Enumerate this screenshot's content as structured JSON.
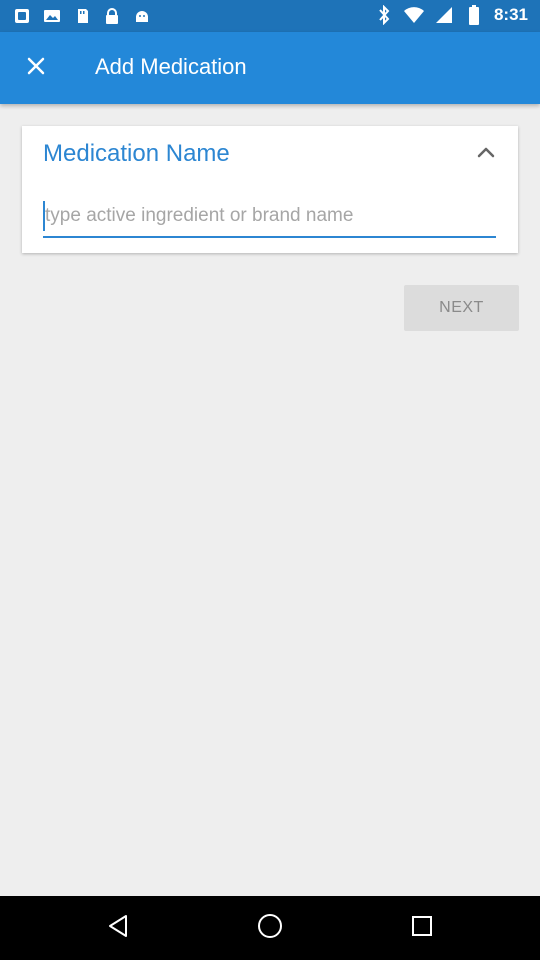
{
  "status_bar": {
    "time": "8:31",
    "left_icons": [
      "notification-app-icon",
      "photo-icon",
      "storage-icon",
      "lock-icon",
      "android-icon"
    ],
    "right_icons": [
      "bluetooth-icon",
      "wifi-icon",
      "signal-icon",
      "battery-icon"
    ]
  },
  "app_bar": {
    "close_icon": "close-icon",
    "title": "Add Medication"
  },
  "medication_card": {
    "title": "Medication Name",
    "collapse_icon": "chevron-up-icon",
    "input_value": "",
    "input_placeholder": "type active ingredient or brand name"
  },
  "next_button": {
    "label": "NEXT"
  },
  "nav_bar": {
    "icons": [
      "back-icon",
      "home-icon",
      "recents-icon"
    ]
  },
  "colors": {
    "status_bar": "#1e73b8",
    "app_bar": "#2388d9",
    "accent": "#2c86d2",
    "background": "#eeeeee"
  }
}
